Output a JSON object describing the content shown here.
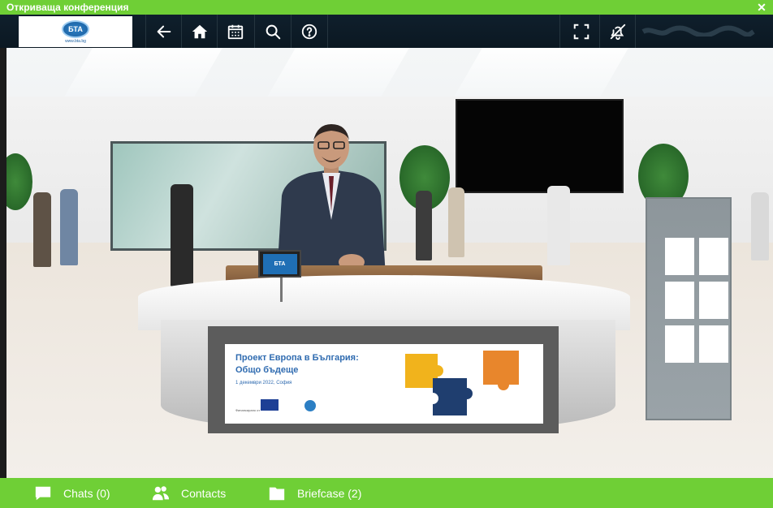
{
  "window": {
    "title": "Откриваща конференция",
    "close_glyph": "✕"
  },
  "toolbar": {
    "logo": {
      "badge_text": "БТА",
      "url_text": "www.bta.bg"
    },
    "buttons": [
      {
        "name": "back-button",
        "icon": "arrow-left-icon"
      },
      {
        "name": "home-button",
        "icon": "home-icon"
      },
      {
        "name": "calendar-button",
        "icon": "calendar-icon"
      },
      {
        "name": "search-button",
        "icon": "search-icon"
      },
      {
        "name": "help-button",
        "icon": "help-icon"
      },
      {
        "name": "fullscreen-button",
        "icon": "fullscreen-icon"
      },
      {
        "name": "notifications-button",
        "icon": "bell-off-icon"
      }
    ]
  },
  "scene": {
    "tablet_text": "БТА",
    "banner": {
      "line1": "Проект Европа в България:",
      "line2": "Общо бъдеще",
      "line3": "1 декември 2022, София",
      "footer": "Финансирано от"
    },
    "puzzle_colors": [
      "#f1b31c",
      "#1f3e6f",
      "#e8862c",
      "#2c7fc4"
    ]
  },
  "bottom_bar": {
    "items": [
      {
        "label": "Chats (0)",
        "icon": "chat-icon"
      },
      {
        "label": "Contacts",
        "icon": "contacts-icon"
      },
      {
        "label": "Briefcase (2)",
        "icon": "briefcase-icon"
      }
    ]
  },
  "colors": {
    "accent": "#6fcf36",
    "toolbar": "#0f1f2c"
  }
}
